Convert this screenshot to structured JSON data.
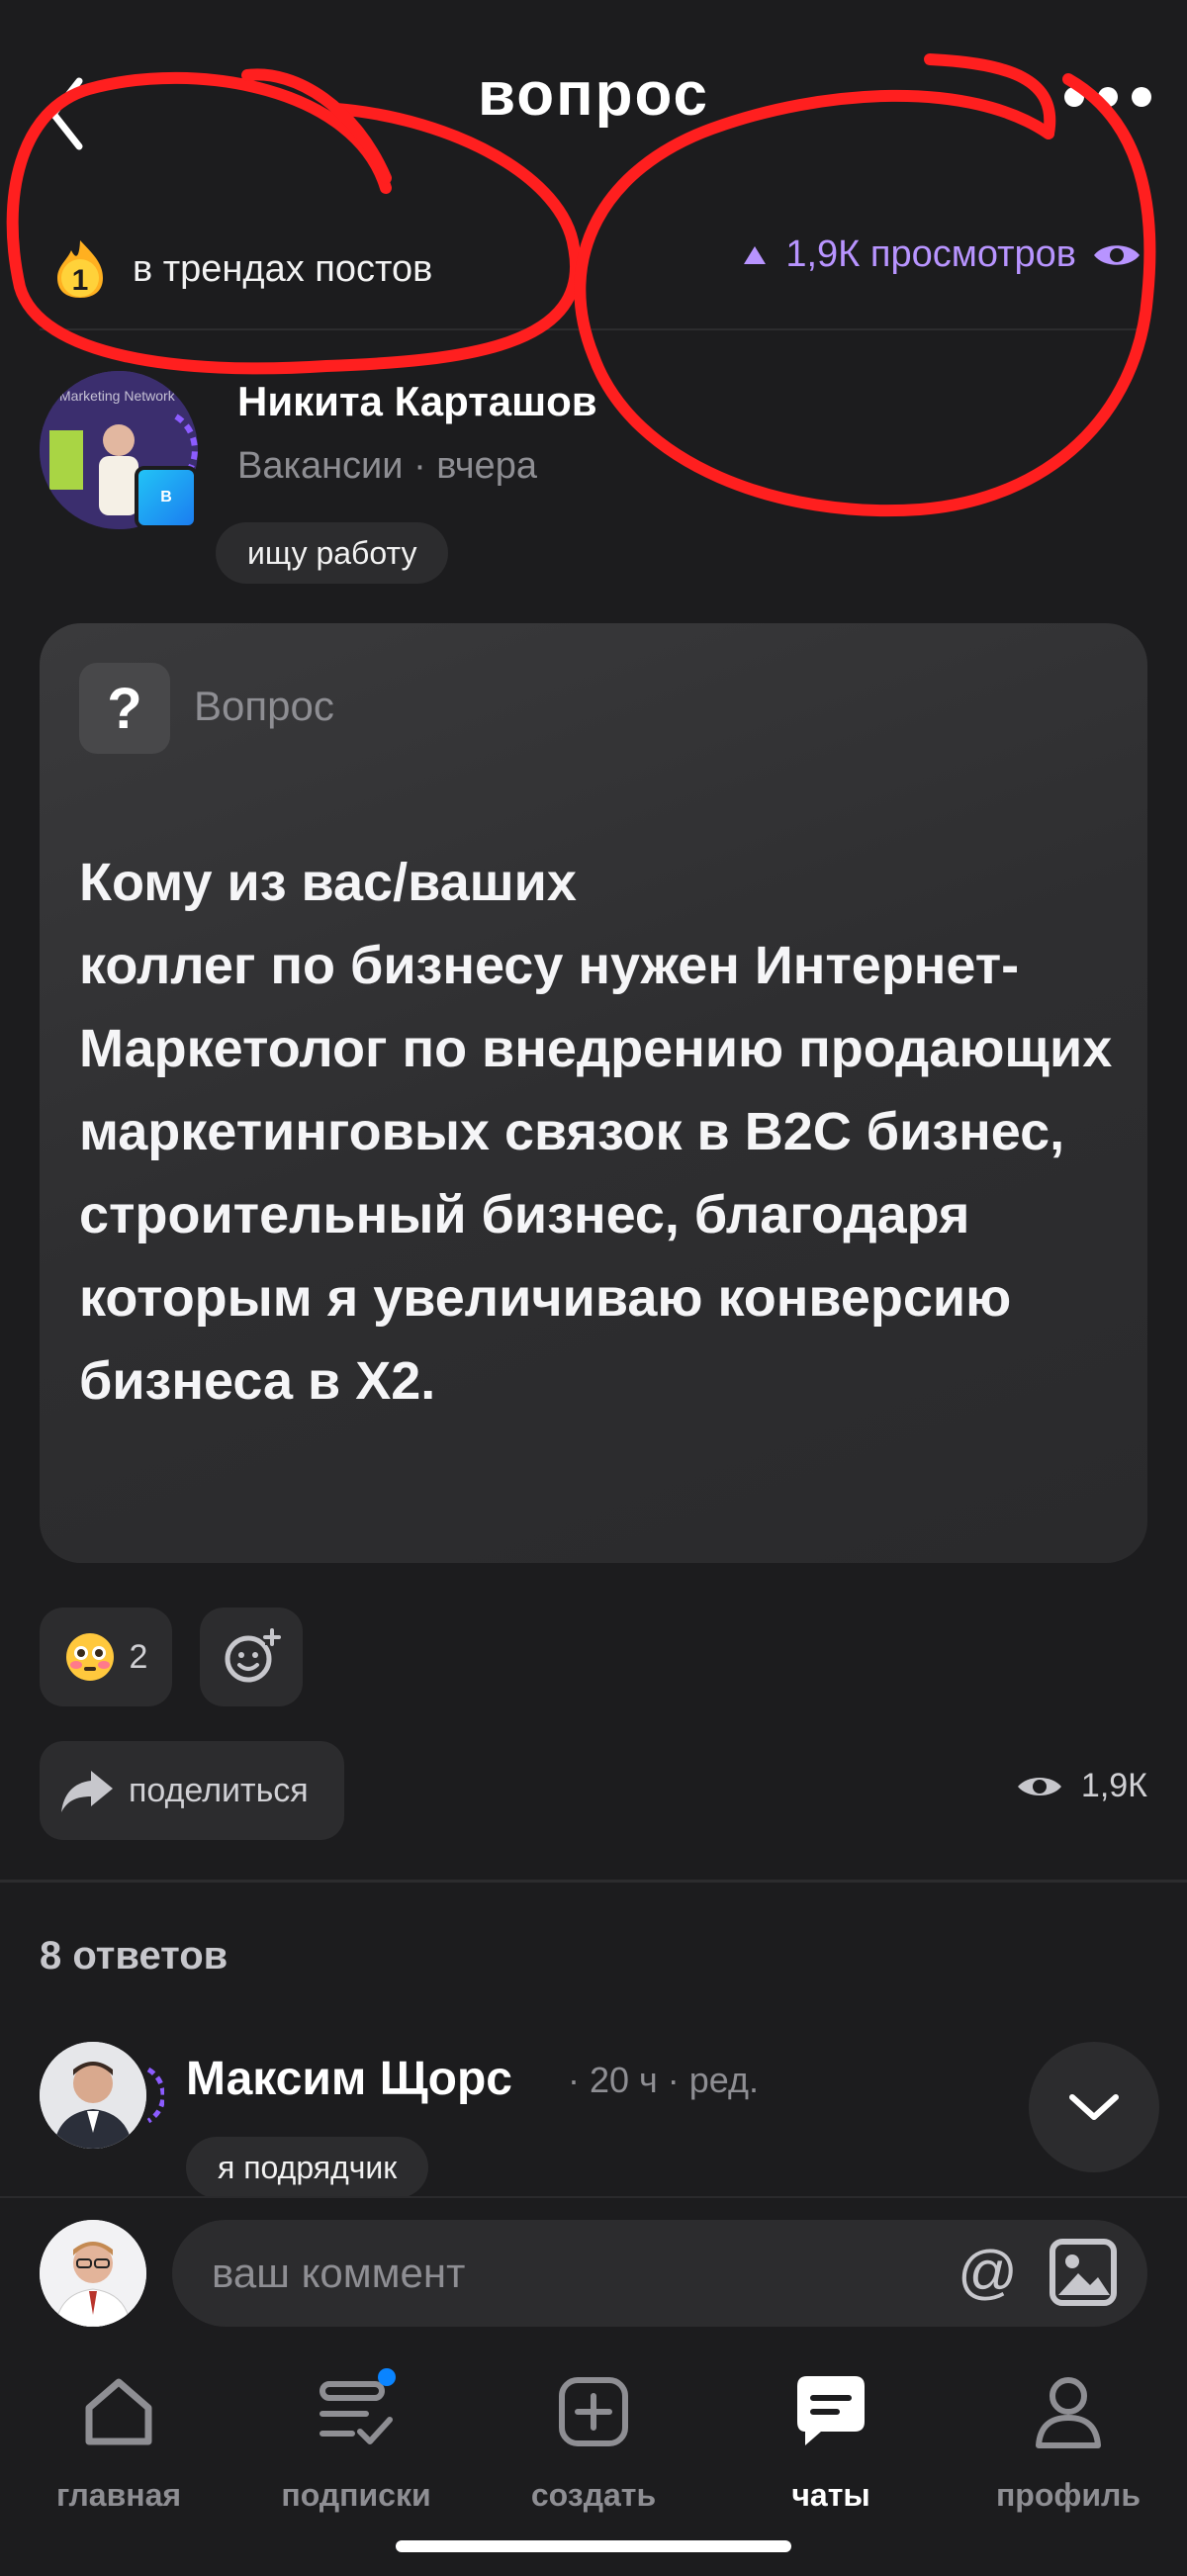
{
  "header": {
    "title": "вопрос",
    "trend_text": "в трендах постов",
    "trend_rank": "1",
    "views_text": "1,9К просмотров"
  },
  "author": {
    "name": "Никита Карташов",
    "meta": "Вакансии · вчера",
    "tag": "ищу работу",
    "avatar_text": "Marketing Network",
    "badge_letter": "B"
  },
  "question": {
    "label": "Вопрос",
    "icon_char": "?",
    "text": "Кому из вас/ваших\nколлег по бизнесу нужен Интернет-Маркетолог по внедрению продающих маркетинговых связок в B2C бизнес, строительный бизнес, благодаря которым я увеличиваю конверсию бизнеса в Х2."
  },
  "reactions": {
    "emoji_count": "2",
    "share_label": "поделиться",
    "views": "1,9К"
  },
  "answers": {
    "count_label": "8 ответов",
    "first": {
      "name": "Максим Щорс",
      "meta": "· 20 ч · ред.",
      "tag": "я подрядчик"
    }
  },
  "composer": {
    "placeholder": "ваш коммент",
    "at_symbol": "@"
  },
  "tabbar": {
    "items": [
      {
        "label": "главная",
        "icon": "home-icon"
      },
      {
        "label": "подписки",
        "icon": "subscriptions-icon"
      },
      {
        "label": "создать",
        "icon": "create-icon"
      },
      {
        "label": "чаты",
        "icon": "chat-icon",
        "active": true
      },
      {
        "label": "профиль",
        "icon": "profile-icon"
      }
    ]
  },
  "colors": {
    "accent_purple": "#b894ff",
    "annotation_red": "#ff1f1f",
    "notification_blue": "#0a84ff"
  }
}
